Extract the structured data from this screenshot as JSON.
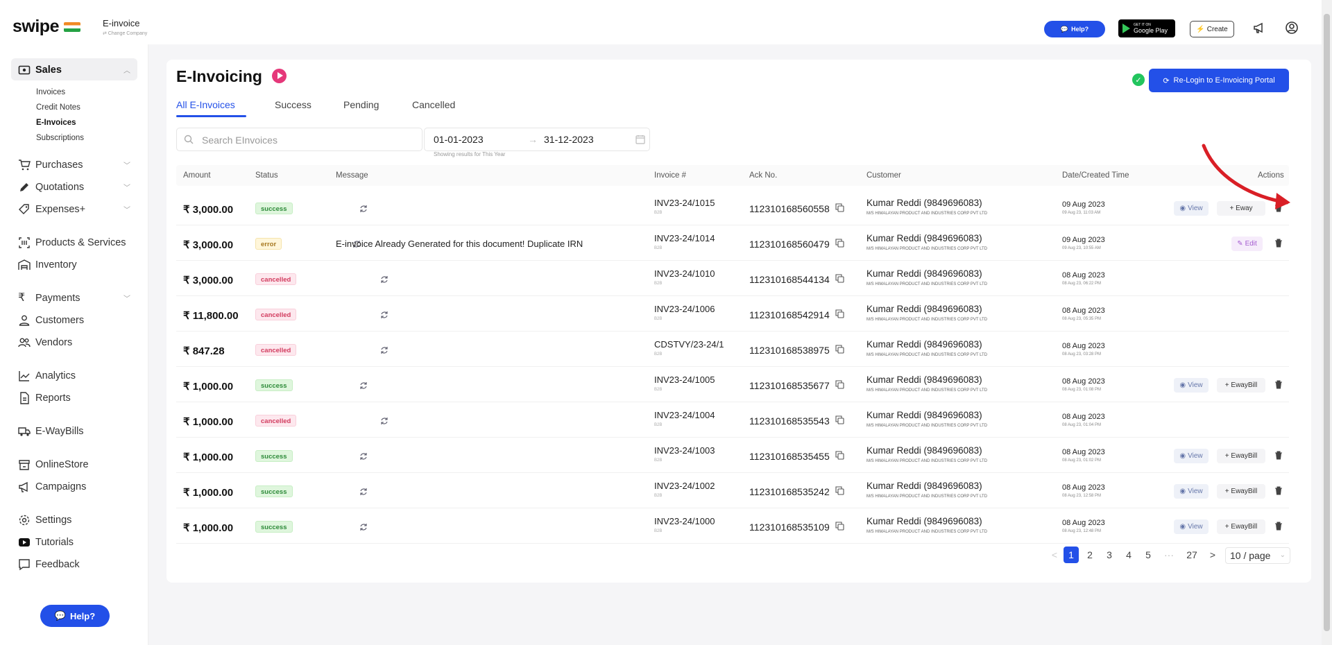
{
  "topbar": {
    "logo": "swipe",
    "company_name": "E-invoice",
    "change_company": "⇄ Change Company",
    "help_label": "Help?",
    "gplay_line1": "GET IT ON",
    "gplay_line2": "Google Play",
    "create_label": "Create"
  },
  "sidebar": {
    "sales": "Sales",
    "sales_sub": [
      "Invoices",
      "Credit Notes",
      "E-Invoices",
      "Subscriptions"
    ],
    "items": [
      "Purchases",
      "Quotations",
      "Expenses+",
      "Products & Services",
      "Inventory",
      "Payments",
      "Customers",
      "Vendors",
      "Analytics",
      "Reports",
      "E-WayBills",
      "OnlineStore",
      "Campaigns",
      "Settings",
      "Tutorials",
      "Feedback"
    ],
    "help_label": "Help?"
  },
  "main": {
    "title": "E-Invoicing",
    "tabs": [
      "All E-Invoices",
      "Success",
      "Pending",
      "Cancelled"
    ],
    "relogin_label": "Re-Login to E-Invoicing Portal",
    "search_placeholder": "Search EInvoices",
    "date_from": "01-01-2023",
    "date_sep": "→",
    "date_to": "31-12-2023",
    "showing_note": "Showing results for This Year",
    "columns": [
      "Amount",
      "Status",
      "Message",
      "Invoice #",
      "Ack No.",
      "Customer",
      "Date/Created Time",
      "Actions"
    ],
    "rows": [
      {
        "amount": "₹ 3,000.00",
        "status": "success",
        "message": "",
        "invoice": "INV23-24/1015",
        "inv_sub": "B2B",
        "ack": "112310168560558",
        "customer": "Kumar Reddi (9849696083)",
        "customer_sub": "M/S HIMALAYAN PRODUCT AND INDUSTRIES CORP PVT LTD",
        "date": "09 Aug 2023",
        "date_sub": "09 Aug 23, 11:03 AM",
        "actions": "view-eway"
      },
      {
        "amount": "₹ 3,000.00",
        "status": "error",
        "message": "E-invoice Already Generated for this document! Duplicate IRN",
        "invoice": "INV23-24/1014",
        "inv_sub": "B2B",
        "ack": "112310168560479",
        "customer": "Kumar Reddi (9849696083)",
        "customer_sub": "M/S HIMALAYAN PRODUCT AND INDUSTRIES CORP PVT LTD",
        "date": "09 Aug 2023",
        "date_sub": "09 Aug 23, 10:55 AM",
        "actions": "edit"
      },
      {
        "amount": "₹ 3,000.00",
        "status": "cancelled",
        "message": "",
        "invoice": "INV23-24/1010",
        "inv_sub": "B2B",
        "ack": "112310168544134",
        "customer": "Kumar Reddi (9849696083)",
        "customer_sub": "M/S HIMALAYAN PRODUCT AND INDUSTRIES CORP PVT LTD",
        "date": "08 Aug 2023",
        "date_sub": "08 Aug 23, 06:22 PM",
        "actions": "none"
      },
      {
        "amount": "₹ 11,800.00",
        "status": "cancelled",
        "message": "",
        "invoice": "INV23-24/1006",
        "inv_sub": "B2B",
        "ack": "112310168542914",
        "customer": "Kumar Reddi (9849696083)",
        "customer_sub": "M/S HIMALAYAN PRODUCT AND INDUSTRIES CORP PVT LTD",
        "date": "08 Aug 2023",
        "date_sub": "08 Aug 23, 05:35 PM",
        "actions": "none"
      },
      {
        "amount": "₹ 847.28",
        "status": "cancelled",
        "message": "",
        "invoice": "CDSTVY/23-24/1",
        "inv_sub": "B2B",
        "ack": "112310168538975",
        "customer": "Kumar Reddi (9849696083)",
        "customer_sub": "M/S HIMALAYAN PRODUCT AND INDUSTRIES CORP PVT LTD",
        "date": "08 Aug 2023",
        "date_sub": "08 Aug 23, 03:28 PM",
        "actions": "none"
      },
      {
        "amount": "₹ 1,000.00",
        "status": "success",
        "message": "",
        "invoice": "INV23-24/1005",
        "inv_sub": "B2B",
        "ack": "112310168535677",
        "customer": "Kumar Reddi (9849696083)",
        "customer_sub": "M/S HIMALAYAN PRODUCT AND INDUSTRIES CORP PVT LTD",
        "date": "08 Aug 2023",
        "date_sub": "08 Aug 23, 01:08 PM",
        "actions": "view-eway"
      },
      {
        "amount": "₹ 1,000.00",
        "status": "cancelled",
        "message": "",
        "invoice": "INV23-24/1004",
        "inv_sub": "B2B",
        "ack": "112310168535543",
        "customer": "Kumar Reddi (9849696083)",
        "customer_sub": "M/S HIMALAYAN PRODUCT AND INDUSTRIES CORP PVT LTD",
        "date": "08 Aug 2023",
        "date_sub": "08 Aug 23, 01:04 PM",
        "actions": "none"
      },
      {
        "amount": "₹ 1,000.00",
        "status": "success",
        "message": "",
        "invoice": "INV23-24/1003",
        "inv_sub": "B2B",
        "ack": "112310168535455",
        "customer": "Kumar Reddi (9849696083)",
        "customer_sub": "M/S HIMALAYAN PRODUCT AND INDUSTRIES CORP PVT LTD",
        "date": "08 Aug 2023",
        "date_sub": "08 Aug 23, 01:02 PM",
        "actions": "view-eway"
      },
      {
        "amount": "₹ 1,000.00",
        "status": "success",
        "message": "",
        "invoice": "INV23-24/1002",
        "inv_sub": "B2B",
        "ack": "112310168535242",
        "customer": "Kumar Reddi (9849696083)",
        "customer_sub": "M/S HIMALAYAN PRODUCT AND INDUSTRIES CORP PVT LTD",
        "date": "08 Aug 2023",
        "date_sub": "08 Aug 23, 12:58 PM",
        "actions": "view-eway"
      },
      {
        "amount": "₹ 1,000.00",
        "status": "success",
        "message": "",
        "invoice": "INV23-24/1000",
        "inv_sub": "B2B",
        "ack": "112310168535109",
        "customer": "Kumar Reddi (9849696083)",
        "customer_sub": "M/S HIMALAYAN PRODUCT AND INDUSTRIES CORP PVT LTD",
        "date": "08 Aug 2023",
        "date_sub": "08 Aug 23, 12:48 PM",
        "actions": "view-eway"
      }
    ],
    "view_label": "View",
    "eway_label": "+ EwayBill",
    "eway_label_cut": "+ Eway",
    "edit_label": "Edit"
  },
  "pagination": {
    "prev": "<",
    "pages": [
      "1",
      "2",
      "3",
      "4",
      "5"
    ],
    "ellipsis": "···",
    "last": "27",
    "next": ">",
    "page_size": "10 / page"
  },
  "colors": {
    "accent": "#2350e8",
    "annotation_arrow": "#d91f26"
  }
}
